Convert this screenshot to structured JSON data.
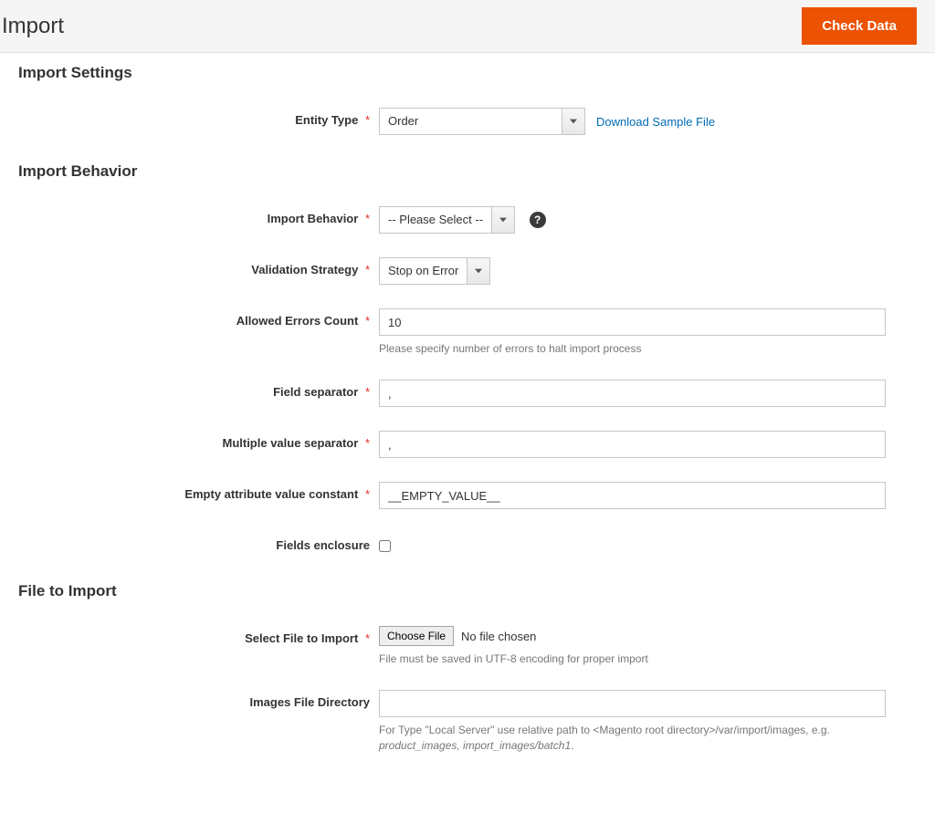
{
  "header": {
    "page_title": "Import",
    "primary_button": "Check Data"
  },
  "sections": {
    "import_settings_title": "Import Settings",
    "import_behavior_title": "Import Behavior",
    "file_to_import_title": "File to Import"
  },
  "fields": {
    "entity_type": {
      "label": "Entity Type",
      "value": "Order",
      "link": "Download Sample File"
    },
    "import_behavior": {
      "label": "Import Behavior",
      "value": "-- Please Select --"
    },
    "validation_strategy": {
      "label": "Validation Strategy",
      "value": "Stop on Error"
    },
    "allowed_errors": {
      "label": "Allowed Errors Count",
      "value": "10",
      "note": "Please specify number of errors to halt import process"
    },
    "field_separator": {
      "label": "Field separator",
      "value": ","
    },
    "multi_separator": {
      "label": "Multiple value separator",
      "value": ","
    },
    "empty_constant": {
      "label": "Empty attribute value constant",
      "value": "__EMPTY_VALUE__"
    },
    "fields_enclosure": {
      "label": "Fields enclosure",
      "checked": false
    },
    "select_file": {
      "label": "Select File to Import",
      "button": "Choose File",
      "status": "No file chosen",
      "note": "File must be saved in UTF-8 encoding for proper import"
    },
    "images_dir": {
      "label": "Images File Directory",
      "value": "",
      "note_prefix": "For Type \"Local Server\" use relative path to <Magento root directory>/var/import/images, e.g. ",
      "note_em": "product_images, import_images/batch1"
    }
  },
  "glyphs": {
    "help": "?"
  }
}
